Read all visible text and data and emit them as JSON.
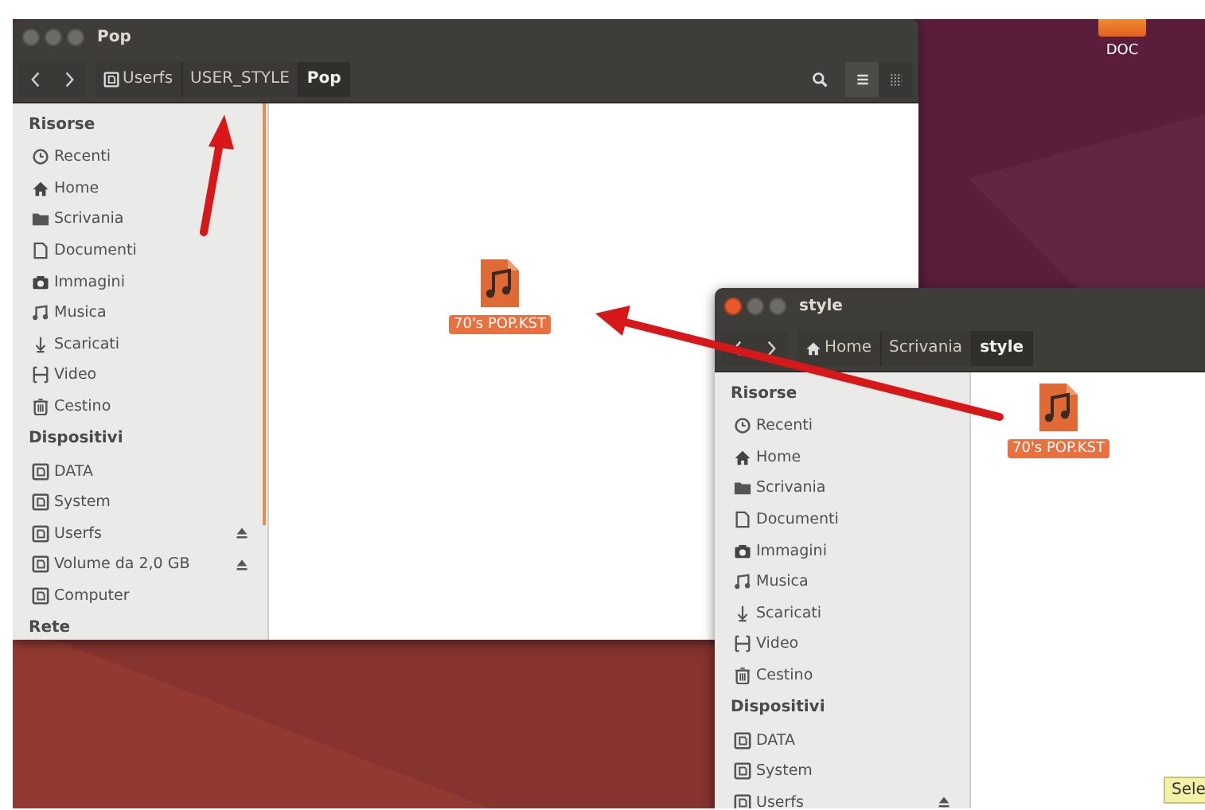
{
  "desktop": {
    "icons": [
      {
        "label": "DOC"
      }
    ]
  },
  "windows": [
    {
      "title": "Pop",
      "active": false,
      "path": [
        {
          "label": "Userfs",
          "kind": "drive",
          "selected": false
        },
        {
          "label": "USER_STYLE",
          "selected": false
        },
        {
          "label": "Pop",
          "selected": true
        }
      ],
      "view_buttons": [
        {
          "kind": "list",
          "selected": true
        },
        {
          "kind": "grid",
          "selected": false
        }
      ],
      "sidebar": [
        {
          "heading": "Risorse",
          "items": [
            {
              "label": "Recenti",
              "kind": "recent",
              "eject": false
            },
            {
              "label": "Home",
              "kind": "home",
              "eject": false
            },
            {
              "label": "Scrivania",
              "kind": "folder",
              "eject": false
            },
            {
              "label": "Documenti",
              "kind": "document",
              "eject": false
            },
            {
              "label": "Immagini",
              "kind": "camera",
              "eject": false
            },
            {
              "label": "Musica",
              "kind": "music",
              "eject": false
            },
            {
              "label": "Scaricati",
              "kind": "download",
              "eject": false
            },
            {
              "label": "Video",
              "kind": "video",
              "eject": false
            },
            {
              "label": "Cestino",
              "kind": "trash",
              "eject": false
            }
          ]
        },
        {
          "heading": "Dispositivi",
          "items": [
            {
              "label": "DATA",
              "kind": "drive",
              "eject": false
            },
            {
              "label": "System",
              "kind": "drive",
              "eject": false
            },
            {
              "label": "Userfs",
              "kind": "drive",
              "eject": true
            },
            {
              "label": "Volume da 2,0 GB",
              "kind": "drive",
              "eject": true
            },
            {
              "label": "Computer",
              "kind": "drive",
              "eject": false
            }
          ]
        },
        {
          "heading": "Rete"
        }
      ],
      "files": [
        {
          "name": "70's POP.KST",
          "selected": true
        }
      ]
    },
    {
      "title": "style",
      "active": true,
      "path": [
        {
          "label": "Home",
          "kind": "home",
          "selected": false
        },
        {
          "label": "Scrivania",
          "selected": false
        },
        {
          "label": "style",
          "selected": true
        }
      ],
      "sidebar": [
        {
          "heading": "Risorse",
          "items": [
            {
              "label": "Recenti",
              "kind": "recent",
              "eject": false
            },
            {
              "label": "Home",
              "kind": "home",
              "eject": false
            },
            {
              "label": "Scrivania",
              "kind": "folder",
              "eject": false
            },
            {
              "label": "Documenti",
              "kind": "document",
              "eject": false
            },
            {
              "label": "Immagini",
              "kind": "camera",
              "eject": false
            },
            {
              "label": "Musica",
              "kind": "music",
              "eject": false
            },
            {
              "label": "Scaricati",
              "kind": "download",
              "eject": false
            },
            {
              "label": "Video",
              "kind": "video",
              "eject": false
            },
            {
              "label": "Cestino",
              "kind": "trash",
              "eject": false
            }
          ]
        },
        {
          "heading": "Dispositivi",
          "items": [
            {
              "label": "DATA",
              "kind": "drive",
              "eject": false
            },
            {
              "label": "System",
              "kind": "drive",
              "eject": false
            },
            {
              "label": "Userfs",
              "kind": "drive",
              "eject": true
            }
          ]
        }
      ],
      "files": [
        {
          "name": "70's POP.KST",
          "selected": true
        }
      ]
    }
  ],
  "tooltip": {
    "text": "Sele"
  }
}
